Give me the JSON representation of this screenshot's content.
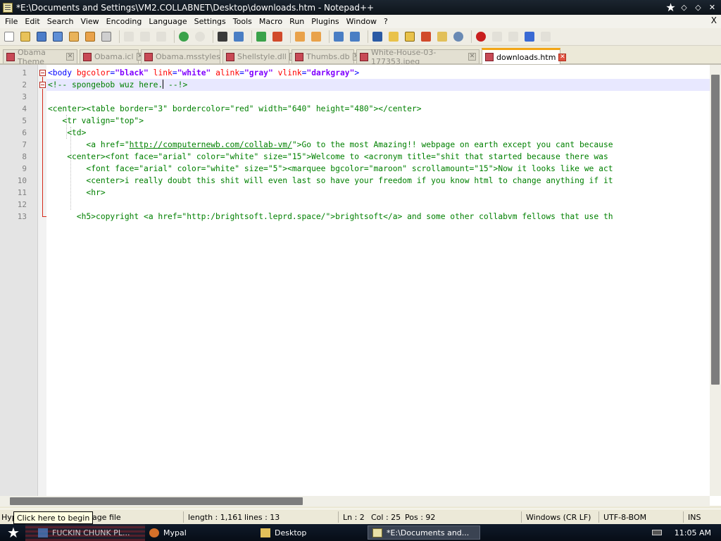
{
  "window": {
    "title": "*E:\\Documents and Settings\\VM2.COLLABNET\\Desktop\\downloads.htm - Notepad++",
    "controls": [
      "★",
      "◇",
      "◇",
      "✕"
    ]
  },
  "menu": {
    "items": [
      "File",
      "Edit",
      "Search",
      "View",
      "Encoding",
      "Language",
      "Settings",
      "Tools",
      "Macro",
      "Run",
      "Plugins",
      "Window",
      "?"
    ],
    "close": "X"
  },
  "toolbar": {
    "icons": [
      "new-file-icon",
      "open-file-icon",
      "save-icon",
      "save-all-icon",
      "close-icon",
      "close-all-icon",
      "print-icon",
      "cut-icon",
      "copy-icon",
      "paste-icon",
      "undo-icon",
      "redo-icon",
      "find-icon",
      "replace-icon",
      "zoom-in-icon",
      "zoom-out-icon",
      "sync-v-icon",
      "sync-h-icon",
      "word-wrap-icon",
      "show-all-chars-icon",
      "indent-guide-icon",
      "lang-icon",
      "doc-map-icon",
      "function-list-icon",
      "folder-icon",
      "monitor-icon",
      "record-macro-icon",
      "stop-macro-icon",
      "play-macro-icon",
      "run-macro-multiple-icon",
      "save-macro-icon"
    ]
  },
  "tabs": [
    {
      "label": "Obama Theme",
      "active": false
    },
    {
      "label": "Obama.icl",
      "active": false
    },
    {
      "label": "Obama.msstyles",
      "active": false
    },
    {
      "label": "Shellstyle.dll",
      "active": false
    },
    {
      "label": "Thumbs.db",
      "active": false
    },
    {
      "label": "White-House-03-177353.jpeg",
      "active": false
    },
    {
      "label": "downloads.htm",
      "active": true
    }
  ],
  "editor": {
    "line_numbers": [
      "1",
      "2",
      "3",
      "4",
      "5",
      "6",
      "7",
      "8",
      "9",
      "10",
      "11",
      "12",
      "13"
    ],
    "lines": [
      [
        {
          "t": "tag",
          "s": "<body "
        },
        {
          "t": "attr",
          "s": "bgcolor"
        },
        {
          "t": "tag",
          "s": "="
        },
        {
          "t": "val",
          "s": "\"black\""
        },
        {
          "t": "tag",
          "s": " "
        },
        {
          "t": "attr",
          "s": "link"
        },
        {
          "t": "tag",
          "s": "="
        },
        {
          "t": "val",
          "s": "\"white\""
        },
        {
          "t": "tag",
          "s": " "
        },
        {
          "t": "attr",
          "s": "alink"
        },
        {
          "t": "tag",
          "s": "="
        },
        {
          "t": "val",
          "s": "\"gray\""
        },
        {
          "t": "tag",
          "s": " "
        },
        {
          "t": "attr",
          "s": "vlink"
        },
        {
          "t": "tag",
          "s": "="
        },
        {
          "t": "val",
          "s": "\"darkgray\""
        },
        {
          "t": "tag",
          "s": ">"
        }
      ],
      [
        {
          "t": "com",
          "s": "<!-- spongebob wuz here."
        },
        {
          "t": "caret",
          "s": ""
        },
        {
          "t": "com",
          "s": " --!>"
        }
      ],
      [],
      [
        {
          "t": "com",
          "s": "<center><table border=\"3\" bordercolor=\"red\" width=\"640\" height=\"480\"></center>"
        }
      ],
      [
        {
          "t": "com",
          "s": "   <tr valign=\"top\">"
        }
      ],
      [
        {
          "t": "com",
          "s": "    <td>"
        }
      ],
      [
        {
          "t": "com",
          "s": "        <a href=\""
        },
        {
          "t": "link",
          "s": "http://computernewb.com/collab-vm/"
        },
        {
          "t": "com",
          "s": "\">Go to the most Amazing!! webpage on earth except you cant because"
        }
      ],
      [
        {
          "t": "com",
          "s": "    <center><font face=\"arial\" color=\"white\" size=\"15\">Welcome to <acronym title=\"shit that started because there was"
        }
      ],
      [
        {
          "t": "com",
          "s": "        <font face=\"arial\" color=\"white\" size=\"5\"><marquee bgcolor=\"maroon\" scrollamount=\"15\">Now it looks like we act"
        }
      ],
      [
        {
          "t": "com",
          "s": "        <center>i really doubt this shit will even last so have your freedom if you know html to change anything if it"
        }
      ],
      [
        {
          "t": "com",
          "s": "        <hr>"
        }
      ],
      [],
      [
        {
          "t": "com",
          "s": "      <h5>copyright <a href=\"http:/brightsoft.leprd.space/\">brightsoft</a> and some other collabvm fellows that use th"
        }
      ]
    ]
  },
  "statusbar": {
    "file_type": "Hyp",
    "file_type_rest": "guage file",
    "length": "length : 1,161",
    "lines": "lines : 13",
    "ln": "Ln : 2",
    "col": "Col : 25",
    "pos": "Pos : 92",
    "eol": "Windows (CR LF)",
    "encoding": "UTF-8-BOM",
    "mode": "INS"
  },
  "tooltip": "Click here to begin",
  "taskbar": {
    "tasks": [
      {
        "label": "FUCKIN CHUNK PL...",
        "active": false
      },
      {
        "label": "Mypal",
        "active": false
      },
      {
        "label": "Desktop",
        "active": false
      },
      {
        "label": "*E:\\Documents and...",
        "active": true
      }
    ],
    "clock": "11:05 AM"
  },
  "colors": {
    "tag": "#0000ff",
    "attribute": "#ff0000",
    "value": "#8000ff",
    "comment": "#008000",
    "current_line": "#e8e8ff",
    "active_tab_accent": "#f2a516"
  }
}
